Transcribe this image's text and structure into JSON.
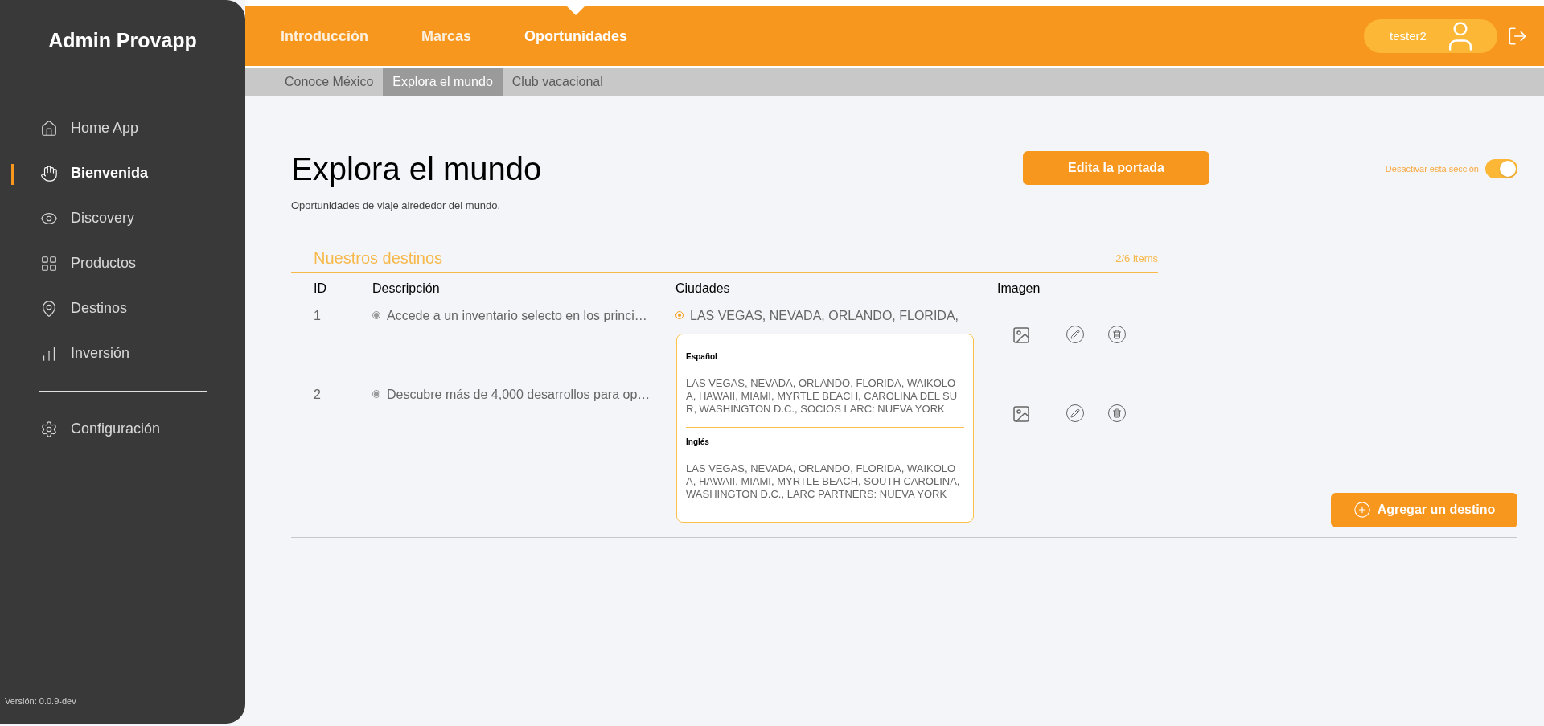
{
  "sidebar": {
    "brand": "Admin Provapp",
    "items": [
      {
        "kind": "home",
        "label": "Home App",
        "selected": false
      },
      {
        "kind": "hand",
        "label": "Bienvenida",
        "selected": true
      },
      {
        "kind": "eye",
        "label": "Discovery",
        "selected": false
      },
      {
        "kind": "grid",
        "label": "Productos",
        "selected": false
      },
      {
        "kind": "pin",
        "label": "Destinos",
        "selected": false
      },
      {
        "kind": "chart",
        "label": "Inversión",
        "selected": false
      }
    ],
    "bottom_items": [
      {
        "kind": "gear",
        "label": "Configuración",
        "selected": false
      }
    ],
    "version": "Versión: 0.0.9-dev"
  },
  "top_nav": [
    {
      "label": "Introducción",
      "selected": false
    },
    {
      "label": "Marcas",
      "selected": false
    },
    {
      "label": "Oportunidades",
      "selected": true
    }
  ],
  "user": {
    "name": "tester2"
  },
  "sub_nav": [
    {
      "label": "Conoce México",
      "selected": false
    },
    {
      "label": "Explora el mundo",
      "selected": true
    },
    {
      "label": "Club vacacional",
      "selected": false
    }
  ],
  "page": {
    "title": "Explora el mundo",
    "subtitle": "Oportunidades de viaje alrededor del mundo.",
    "edit_button": "Edita la portada",
    "toggle": {
      "label": "Desactivar esta sección",
      "on": true
    }
  },
  "section": {
    "title": "Nuestros destinos",
    "count": "2/6 items",
    "columns": [
      "ID",
      "Descripción",
      "Ciudades",
      "Imagen"
    ],
    "rows": [
      {
        "id": "1",
        "description": "Accede a un inventario selecto en los princi…",
        "cities": "LAS VEGAS, NEVADA, ORLANDO, FLORIDA,"
      },
      {
        "id": "2",
        "description": "Descubre más de 4,000 desarrollos para op…"
      }
    ],
    "popup": {
      "sections": [
        {
          "label": "Español",
          "text": "LAS VEGAS, NEVADA, ORLANDO, FLORIDA, WAIKOLOA, HAWAII, MIAMI, MYRTLE BEACH, CAROLINA DEL SUR, WASHINGTON D.C., SOCIOS LARC: NUEVA YORK"
        },
        {
          "label": "Inglés",
          "text": "LAS VEGAS, NEVADA, ORLANDO, FLORIDA, WAIKOLOA, HAWAII, MIAMI, MYRTLE BEACH, SOUTH CAROLINA, WASHINGTON D.C., LARC PARTNERS: NUEVA YORK"
        }
      ]
    },
    "add_button": "Agregar un destino"
  }
}
